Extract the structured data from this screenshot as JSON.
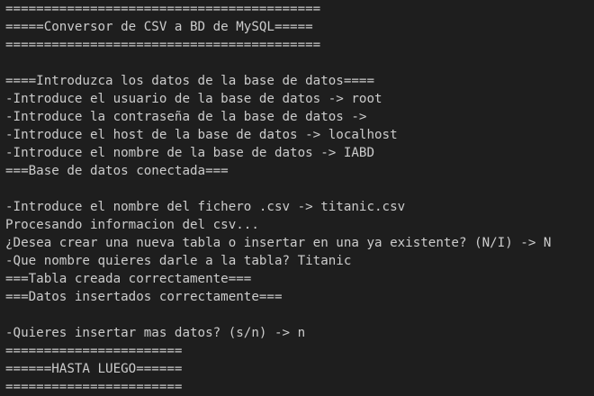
{
  "terminal": {
    "lines": [
      "=========================================",
      "=====Conversor de CSV a BD de MySQL=====",
      "=========================================",
      "",
      "====Introduzca los datos de la base de datos====",
      "-Introduce el usuario de la base de datos -> root",
      "-Introduce la contraseña de la base de datos ->",
      "-Introduce el host de la base de datos -> localhost",
      "-Introduce el nombre de la base de datos -> IABD",
      "===Base de datos conectada===",
      "",
      "-Introduce el nombre del fichero .csv -> titanic.csv",
      "Procesando informacion del csv...",
      "¿Desea crear una nueva tabla o insertar en una ya existente? (N/I) -> N",
      "-Que nombre quieres darle a la tabla? Titanic",
      "===Tabla creada correctamente===",
      "===Datos insertados correctamente===",
      "",
      "-Quieres insertar mas datos? (s/n) -> n",
      "=======================",
      "======HASTA LUEGO======",
      "======================="
    ]
  }
}
